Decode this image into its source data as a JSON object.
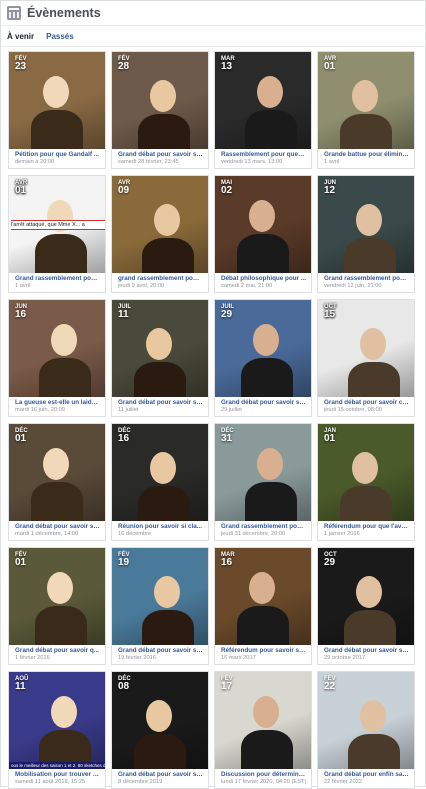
{
  "header": {
    "title": "Évènements",
    "icon": "calendar-icon"
  },
  "tabs": [
    {
      "label": "À venir",
      "active": true
    },
    {
      "label": "Passés",
      "active": false
    }
  ],
  "events": [
    {
      "month": "FÉV",
      "day": "23",
      "title": "Pétition pour que Gandalf ...",
      "date": "demain à 20:00",
      "bg": "#8a6a45"
    },
    {
      "month": "FÉV",
      "day": "28",
      "title": "Grand débat pour savoir si ...",
      "date": "samedi 28 février, 23:45",
      "bg": "#6e5a4a"
    },
    {
      "month": "MAR",
      "day": "13",
      "title": "Rassemblement pour que le...",
      "date": "vendredi 13 mars, 13:00",
      "bg": "#2a2a2a"
    },
    {
      "month": "AVR",
      "day": "01",
      "title": "Grande battue pour élimine...",
      "date": "1 avril",
      "bg": "#8f8f6f"
    },
    {
      "month": "AVR",
      "day": "01",
      "title": "Grand rassemblement pour ...",
      "date": "1 avril",
      "bg": "#f4f4f4",
      "caption": "l'arrêt attaqué, que Mme X... a"
    },
    {
      "month": "AVR",
      "day": "09",
      "title": "grand rassemblement pour ...",
      "date": "jeudi 9 avril, 20:00",
      "bg": "#8a6a3a"
    },
    {
      "month": "MAI",
      "day": "02",
      "title": "Débat philosophique pour ...",
      "date": "samedi 2 mai, 21:00",
      "bg": "#5a3a28"
    },
    {
      "month": "JUN",
      "day": "12",
      "title": "Grand rassemblement pour ...",
      "date": "vendredi 12 juin, 21:00",
      "bg": "#3a4a4a"
    },
    {
      "month": "JUN",
      "day": "16",
      "title": "La gueuse est-elle un laider...",
      "date": "mardi 16 juin, 20:00",
      "bg": "#7a5a48"
    },
    {
      "month": "JUIL",
      "day": "11",
      "title": "Grand débat pour savoir si ...",
      "date": "11 juillet",
      "bg": "#4a4a3a"
    },
    {
      "month": "JUIL",
      "day": "29",
      "title": "Grand débat pour savoir si ...",
      "date": "29 juillet",
      "bg": "#4a6a9a"
    },
    {
      "month": "OCT",
      "day": "15",
      "title": "Grand débat pour savoir co...",
      "date": "jeudi 15 octobre, 08:00",
      "bg": "#e8e8e8"
    },
    {
      "month": "DÉC",
      "day": "01",
      "title": "Grand débat pour savoir si ...",
      "date": "mardi 1 décembre, 14:00",
      "bg": "#5a4a38"
    },
    {
      "month": "DÉC",
      "day": "16",
      "title": "Réunion pour savoir si cla...",
      "date": "16 décembre",
      "bg": "#2a2a28"
    },
    {
      "month": "DÉC",
      "day": "31",
      "title": "Grand rassemblement pour ...",
      "date": "jeudi 31 décembre, 20:00",
      "bg": "#8a9a9a"
    },
    {
      "month": "JAN",
      "day": "01",
      "title": "Référendum pour que l'ave...",
      "date": "1 janvier 2016",
      "bg": "#4a5a2a"
    },
    {
      "month": "FÉV",
      "day": "01",
      "title": "Grand débat pour savoir q...",
      "date": "1 février 2016",
      "bg": "#5a5a3a"
    },
    {
      "month": "FÉV",
      "day": "19",
      "title": "Grand débat pour savoir si ...",
      "date": "19 février 2016",
      "bg": "#4a7a9a"
    },
    {
      "month": "MAR",
      "day": "16",
      "title": "Référendum pour savoir si l...",
      "date": "16 mars 2017",
      "bg": "#6a4a2a"
    },
    {
      "month": "OCT",
      "day": "29",
      "title": "Grand débat pour savoir si ...",
      "date": "29 octobre 2017",
      "bg": "#1a1a1a"
    },
    {
      "month": "AOÛ",
      "day": "11",
      "title": "Mobilisation pour trouver J...",
      "date": "samedi 11 août 2018, 15:25",
      "bg": "#3a3a8a",
      "caption": "ous le meilleur des saison 1 et 2. 80 sketches des émissions"
    },
    {
      "month": "DÉC",
      "day": "08",
      "title": "Grand débat pour savoir si ...",
      "date": "8 décembre 2019",
      "bg": "#1a1a1a"
    },
    {
      "month": "FÉV",
      "day": "17",
      "title": "Discussion pour déterminer ...",
      "date": "lundi 17 février 2020, 04:20 (EST)",
      "bg": "#d8d8d0"
    },
    {
      "month": "FÉV",
      "day": "22",
      "title": "Grand débat pour enfin sav...",
      "date": "22 février 2022",
      "bg": "#c8d0d8"
    }
  ]
}
